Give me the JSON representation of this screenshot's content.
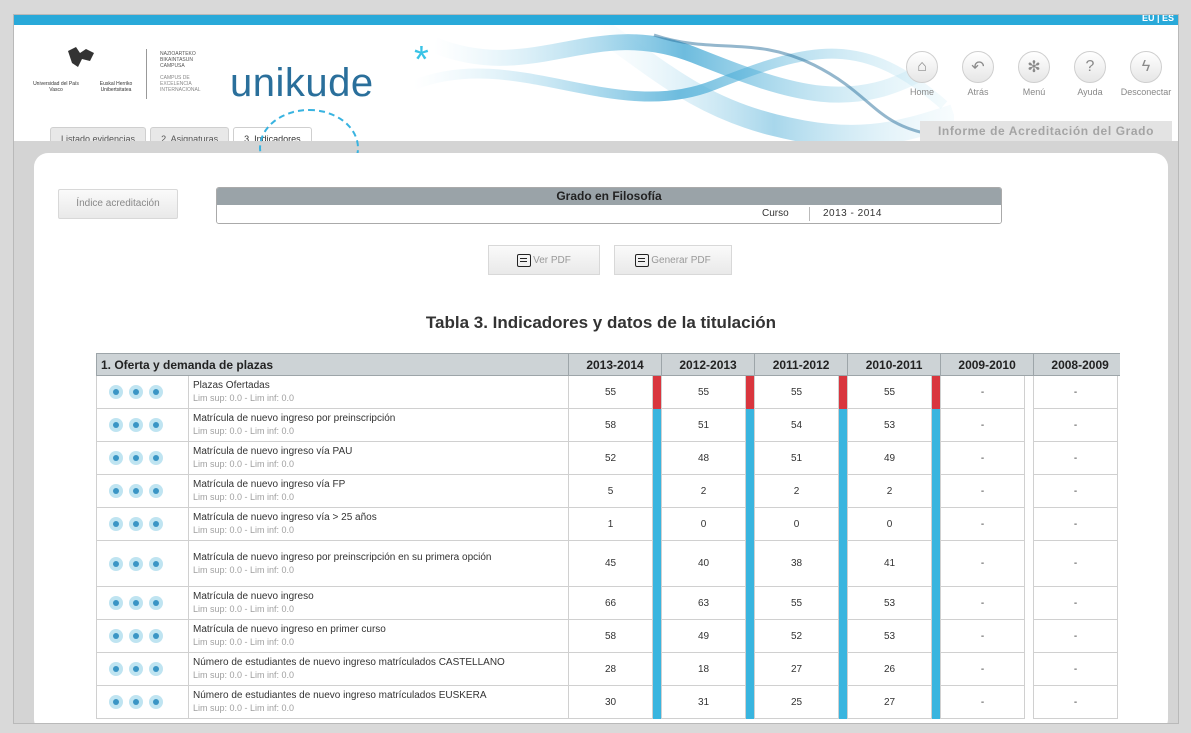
{
  "topbar": {
    "language": "EU | ES"
  },
  "logo": {
    "upv_lines": [
      "Universidad del País Vasco",
      "Euskal Herriko Unibertsitatea"
    ],
    "campus_lines": [
      "NAZIOARTEKO",
      "BIKAINTASUN",
      "CAMPUSA"
    ],
    "campus_sub_lines": [
      "CAMPUS DE",
      "EXCELENCIA",
      "INTERNACIONAL"
    ],
    "brand": "unikude",
    "brand_star": "*"
  },
  "tabs": [
    {
      "label": "Listado evidencias",
      "active": false
    },
    {
      "label": "2. Asignaturas",
      "active": false
    },
    {
      "label": "3. Indicadores",
      "active": true
    }
  ],
  "nav": [
    {
      "label": "Home",
      "icon": "home-icon",
      "glyph": "⌂"
    },
    {
      "label": "Atrás",
      "icon": "back-arrow-icon",
      "glyph": "↶"
    },
    {
      "label": "Menú",
      "icon": "menu-snowflake-icon",
      "glyph": "✻"
    },
    {
      "label": "Ayuda",
      "icon": "help-icon",
      "glyph": "?"
    },
    {
      "label": "Desconectar",
      "icon": "lightning-icon",
      "glyph": "ϟ"
    }
  ],
  "informe_label": "Informe de Acreditación del Grado",
  "indice_button": "Índice acreditación",
  "grado": {
    "title": "Grado en Filosofía",
    "curso_label": "Curso",
    "curso_value": "2013 - 2014"
  },
  "pdf_buttons": {
    "ver": "Ver PDF",
    "generar": "Generar PDF"
  },
  "table_title": "Tabla 3. Indicadores y datos de la titulación",
  "table": {
    "section": "1. Oferta y demanda de plazas",
    "years": [
      "2013-2014",
      "2012-2013",
      "2011-2012",
      "2010-2011",
      "2009-2010",
      "2008-2009"
    ],
    "rows": [
      {
        "desc": "Plazas Ofertadas",
        "lim": "Lim sup: 0.0   -   Lim inf: 0.0",
        "values": [
          "55",
          "55",
          "55",
          "55",
          "-",
          "-"
        ],
        "bar": "red"
      },
      {
        "desc": "Matrícula de nuevo ingreso por preinscripción",
        "lim": "Lim sup: 0.0   -   Lim inf: 0.0",
        "values": [
          "58",
          "51",
          "54",
          "53",
          "-",
          "-"
        ],
        "bar": "blue"
      },
      {
        "desc": "Matrícula de nuevo ingreso vía PAU",
        "lim": "Lim sup: 0.0   -   Lim inf: 0.0",
        "values": [
          "52",
          "48",
          "51",
          "49",
          "-",
          "-"
        ],
        "bar": "blue"
      },
      {
        "desc": "Matrícula de nuevo ingreso vía FP",
        "lim": "Lim sup: 0.0   -   Lim inf: 0.0",
        "values": [
          "5",
          "2",
          "2",
          "2",
          "-",
          "-"
        ],
        "bar": "blue"
      },
      {
        "desc": "Matrícula de nuevo ingreso vía > 25 años",
        "lim": "Lim sup: 0.0   -   Lim inf: 0.0",
        "values": [
          "1",
          "0",
          "0",
          "0",
          "-",
          "-"
        ],
        "bar": "blue"
      },
      {
        "desc": "Matrícula de nuevo ingreso por preinscripción en su primera opción",
        "lim": "Lim sup: 0.0   -   Lim inf: 0.0",
        "values": [
          "45",
          "40",
          "38",
          "41",
          "-",
          "-"
        ],
        "bar": "blue"
      },
      {
        "desc": "Matrícula de nuevo ingreso",
        "lim": "Lim sup: 0.0   -   Lim inf: 0.0",
        "values": [
          "66",
          "63",
          "55",
          "53",
          "-",
          "-"
        ],
        "bar": "blue"
      },
      {
        "desc": "Matrícula de nuevo ingreso en primer curso",
        "lim": "Lim sup: 0.0   -   Lim inf: 0.0",
        "values": [
          "58",
          "49",
          "52",
          "53",
          "-",
          "-"
        ],
        "bar": "blue"
      },
      {
        "desc": "Número de estudiantes de nuevo ingreso matrículados CASTELLANO",
        "lim": "Lim sup: 0.0   -   Lim inf: 0.0",
        "values": [
          "28",
          "18",
          "27",
          "26",
          "-",
          "-"
        ],
        "bar": "blue"
      },
      {
        "desc": "Número de estudiantes de nuevo ingreso matrículados EUSKERA",
        "lim": "Lim sup: 0.0   -   Lim inf: 0.0",
        "values": [
          "30",
          "31",
          "25",
          "27",
          "-",
          "-"
        ],
        "bar": "blue"
      }
    ]
  },
  "colors": {
    "accent": "#29a9d9",
    "bar_red": "#d9363e",
    "bar_blue": "#39b5df",
    "brand": "#2a6f9b"
  }
}
